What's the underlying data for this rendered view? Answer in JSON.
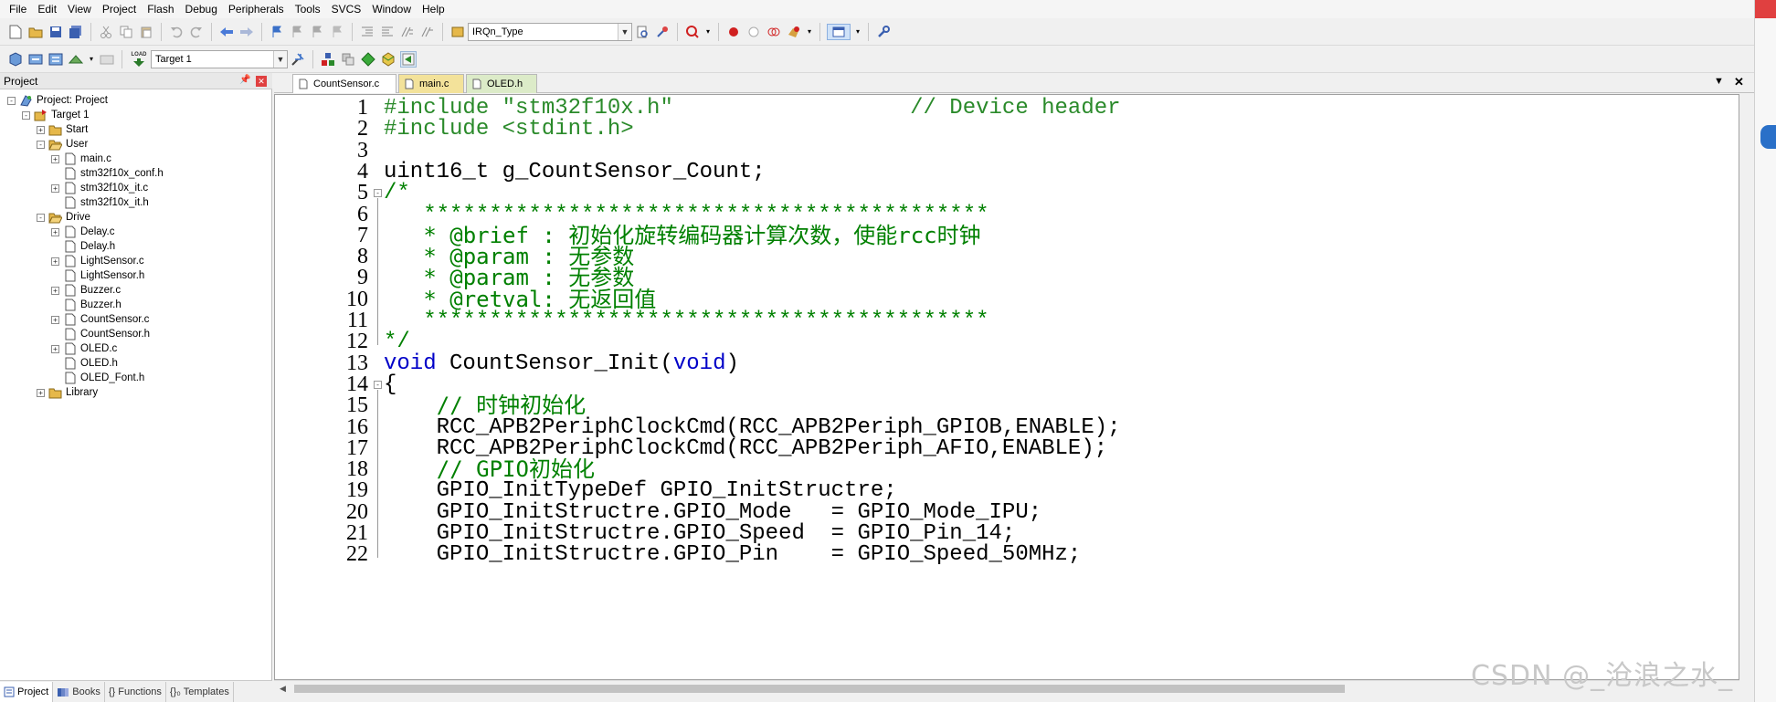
{
  "menu": [
    "File",
    "Edit",
    "View",
    "Project",
    "Flash",
    "Debug",
    "Peripherals",
    "Tools",
    "SVCS",
    "Window",
    "Help"
  ],
  "toolbar1": {
    "search_combo": "IRQn_Type"
  },
  "toolbar2": {
    "target_combo": "Target 1",
    "load_label": "LOAD"
  },
  "project_panel": {
    "title": "Project"
  },
  "tree": [
    {
      "label": "Project: Project",
      "level": 0,
      "expander": "−",
      "icon": "project-icon"
    },
    {
      "label": "Target 1",
      "level": 1,
      "expander": "−",
      "icon": "target-icon"
    },
    {
      "label": "Start",
      "level": 2,
      "expander": "+",
      "icon": "folder-icon"
    },
    {
      "label": "User",
      "level": 2,
      "expander": "−",
      "icon": "folder-open-icon"
    },
    {
      "label": "main.c",
      "level": 3,
      "expander": "+",
      "icon": "file-icon"
    },
    {
      "label": "stm32f10x_conf.h",
      "level": 3,
      "expander": "",
      "icon": "file-icon"
    },
    {
      "label": "stm32f10x_it.c",
      "level": 3,
      "expander": "+",
      "icon": "file-icon"
    },
    {
      "label": "stm32f10x_it.h",
      "level": 3,
      "expander": "",
      "icon": "file-icon"
    },
    {
      "label": "Drive",
      "level": 2,
      "expander": "−",
      "icon": "folder-open-icon"
    },
    {
      "label": "Delay.c",
      "level": 3,
      "expander": "+",
      "icon": "file-icon"
    },
    {
      "label": "Delay.h",
      "level": 3,
      "expander": "",
      "icon": "file-icon"
    },
    {
      "label": "LightSensor.c",
      "level": 3,
      "expander": "+",
      "icon": "file-icon"
    },
    {
      "label": "LightSensor.h",
      "level": 3,
      "expander": "",
      "icon": "file-icon"
    },
    {
      "label": "Buzzer.c",
      "level": 3,
      "expander": "+",
      "icon": "file-icon"
    },
    {
      "label": "Buzzer.h",
      "level": 3,
      "expander": "",
      "icon": "file-icon"
    },
    {
      "label": "CountSensor.c",
      "level": 3,
      "expander": "+",
      "icon": "file-icon"
    },
    {
      "label": "CountSensor.h",
      "level": 3,
      "expander": "",
      "icon": "file-icon"
    },
    {
      "label": "OLED.c",
      "level": 3,
      "expander": "+",
      "icon": "file-icon"
    },
    {
      "label": "OLED.h",
      "level": 3,
      "expander": "",
      "icon": "file-icon"
    },
    {
      "label": "OLED_Font.h",
      "level": 3,
      "expander": "",
      "icon": "file-icon"
    },
    {
      "label": "Library",
      "level": 2,
      "expander": "+",
      "icon": "folder-icon"
    }
  ],
  "panel_tabs": [
    "Project",
    "Books",
    "{} Functions",
    "{}₀ Templates"
  ],
  "editor_tabs": [
    {
      "label": "CountSensor.c",
      "active": true,
      "color": "#ffffff"
    },
    {
      "label": "main.c",
      "active": false,
      "color": "#f3e29a"
    },
    {
      "label": "OLED.h",
      "active": false,
      "color": "#dcebc8"
    }
  ],
  "code_lines": [
    [
      {
        "t": "#include \"stm32f10x.h\"                  // Device header",
        "c": "pp"
      }
    ],
    [
      {
        "t": "#include <stdint.h>",
        "c": "pp"
      }
    ],
    [],
    [
      {
        "t": "uint16_t g_CountSensor_Count;",
        "c": ""
      }
    ],
    [
      {
        "t": "/*",
        "c": "cm"
      }
    ],
    [
      {
        "t": "   *******************************************",
        "c": "cm"
      }
    ],
    [
      {
        "t": "   * @brief : 初始化旋转编码器计算次数，使能rcc时钟",
        "c": "cm"
      }
    ],
    [
      {
        "t": "   * @param : 无参数",
        "c": "cm"
      }
    ],
    [
      {
        "t": "   * @param : 无参数",
        "c": "cm"
      }
    ],
    [
      {
        "t": "   * @retval: 无返回值",
        "c": "cm"
      }
    ],
    [
      {
        "t": "   *******************************************",
        "c": "cm"
      }
    ],
    [
      {
        "t": "*/",
        "c": "cm"
      }
    ],
    [
      {
        "t": "void",
        "c": "kw"
      },
      {
        "t": " CountSensor_Init(",
        "c": ""
      },
      {
        "t": "void",
        "c": "kw"
      },
      {
        "t": ")",
        "c": ""
      }
    ],
    [
      {
        "t": "{",
        "c": ""
      }
    ],
    [
      {
        "t": "    // 时钟初始化",
        "c": "cm"
      }
    ],
    [
      {
        "t": "    RCC_APB2PeriphClockCmd(RCC_APB2Periph_GPIOB,ENABLE);",
        "c": ""
      }
    ],
    [
      {
        "t": "    RCC_APB2PeriphClockCmd(RCC_APB2Periph_AFIO,ENABLE);",
        "c": ""
      }
    ],
    [
      {
        "t": "    // GPIO初始化",
        "c": "cm"
      }
    ],
    [
      {
        "t": "    GPIO_InitTypeDef GPIO_InitStructre;",
        "c": ""
      }
    ],
    [
      {
        "t": "    GPIO_InitStructre.GPIO_Mode   = GPIO_Mode_IPU;",
        "c": ""
      }
    ],
    [
      {
        "t": "    GPIO_InitStructre.GPIO_Speed  = GPIO_Pin_14;",
        "c": ""
      }
    ],
    [
      {
        "t": "    GPIO_InitStructre.GPIO_Pin    = GPIO_Speed_50MHz;",
        "c": ""
      }
    ]
  ],
  "watermark": "CSDN @_沧浪之水_",
  "colors": {
    "preprocessor": "#2a8a2a",
    "comment": "#008000",
    "keyword": "#0000c8"
  }
}
